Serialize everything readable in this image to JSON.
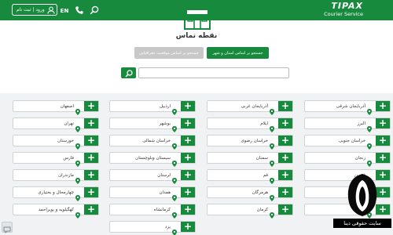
{
  "header": {
    "logo_main": "TIPAX",
    "logo_sub": "Courier Service",
    "login_label": "ورود | ثبت نام",
    "lang_label": "EN",
    "icons": {
      "search": "search-icon",
      "phone": "phone-icon",
      "user": "user-icon"
    }
  },
  "hero": {
    "icon": "store-icon",
    "title": "نقطه تماس"
  },
  "tabs": {
    "city_label": "جستجو بر اساس استان و شهر",
    "geo_label": "جستجو بر اساس موقعیت جغرافیایی"
  },
  "search": {
    "value": "",
    "placeholder": ""
  },
  "columns": [
    [
      "آذربایجان شرقی",
      "البرز",
      "خراسان جنوبی",
      "زنجان",
      "قزوین",
      "کرمانشاه",
      "گیلان"
    ],
    [
      "آذربایجان غربی",
      "ایلام",
      "خراسان رضوی",
      "سمنان",
      "قم",
      "هرمزگان",
      "کرمان"
    ],
    [
      "اردبیل",
      "بوشهر",
      "خراسان شمالی",
      "سیستان وبلوچستان",
      "لرستان",
      "همدان",
      "کرمانشاه",
      "یزد"
    ],
    [
      "اصفهان",
      "تهران",
      "خوزستان",
      "فارس",
      "مازندران",
      "چهارمحال و بختیاری",
      "کهگیلویه و بویراحمد"
    ]
  ],
  "watermark": {
    "text": "سایت حقوقی دینا"
  },
  "colors": {
    "brand": "#178a3e",
    "grid_bg": "#f1f2f4",
    "tab_inactive": "#c8c8c8"
  }
}
